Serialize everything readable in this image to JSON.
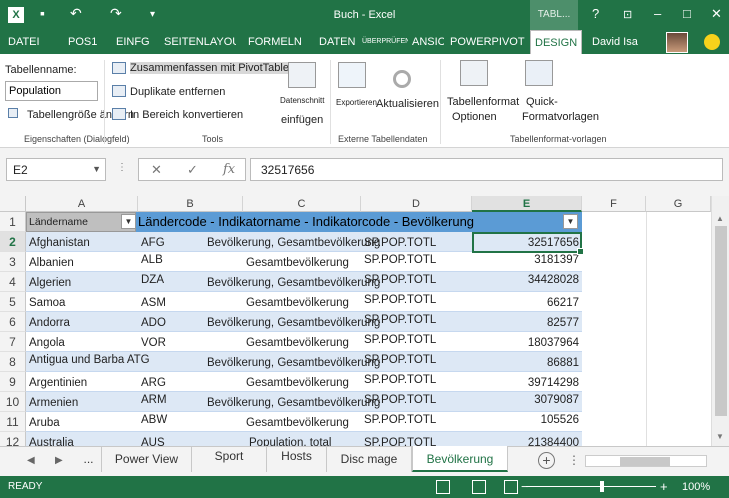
{
  "titlebar": {
    "app_icon": "X",
    "title": "Buch - Excel",
    "context_tab": "TABL...",
    "help": "?",
    "minimize": "–",
    "restore": "□",
    "close": "✕"
  },
  "ribbon_tabs": [
    "DATEI",
    "POS1",
    "EINFG",
    "SEITENLAYOU",
    "FORMELN",
    "DATEN",
    "ÜBERPRÜFEN",
    "ANSICHT",
    "POWERPIVOT",
    "DESIGN"
  ],
  "user": "David Isa",
  "ribbon": {
    "table_name_label": "Tabellenname:",
    "table_name_value": "Population",
    "resize_table": "Tabellengröße ändern",
    "summarize_pivot": "Zusammenfassen mit PivotTable",
    "remove_duplicates": "Duplikate entfernen",
    "convert_range": "In Bereich konvertieren",
    "slicer_label": "Datenschnitt",
    "slicer_label2": "einfügen",
    "export_label": "Exportieren",
    "refresh_label": "Aktualisieren",
    "style_options": "Tabellenformat",
    "style_options2": "Optionen",
    "quick_styles": "Quick-",
    "quick_styles2": "Formatvorlagen",
    "group_properties": "Eigenschaften (Dialogfeld)",
    "group_tools": "Tools",
    "group_external": "Externe Tabellendaten",
    "group_styles": "Tabellenformat-vorlagen"
  },
  "formula_bar": {
    "cell_ref": "E2",
    "cancel": "✕",
    "confirm": "✓",
    "fx": "fx",
    "value": "32517656"
  },
  "columns": [
    "A",
    "B",
    "C",
    "D",
    "E",
    "F",
    "G"
  ],
  "table_header": {
    "col_a": "Ländername",
    "merged": "Ländercode - Indikatorname - Indikatorcode - Bevölkerung"
  },
  "rows": [
    {
      "num": "1"
    },
    {
      "num": "2",
      "a": "Afghanistan",
      "b": "AFG",
      "c": "Bevölkerung, Gesamtbevölkerung",
      "d": "SP.POP.TOTL",
      "e": "32517656"
    },
    {
      "num": "3",
      "a": "Albanien",
      "b": "ALB",
      "c": "Gesamtbevölkerung",
      "d": "SP.POP.TOTL",
      "e": "3181397"
    },
    {
      "num": "4",
      "a": "Algerien",
      "b": "DZA",
      "c": "Bevölkerung, Gesamtbevölkerung",
      "d": "SP.POP.TOTL",
      "e": "34428028"
    },
    {
      "num": "5",
      "a": "Samoa",
      "b": "ASM",
      "c": "Gesamtbevölkerung",
      "d": "SP.POP.TOTL",
      "e": "66217"
    },
    {
      "num": "6",
      "a": "Andorra",
      "b": "ADO",
      "c": "Bevölkerung, Gesamtbevölkerung",
      "d": "SP.POP.TOTL",
      "e": "82577"
    },
    {
      "num": "7",
      "a": "Angola",
      "b": "VOR",
      "c": "Gesamtbevölkerung",
      "d": "SP.POP.TOTL",
      "e": "18037964"
    },
    {
      "num": "8",
      "a": "Antigua und Barba ATG",
      "b": "",
      "c": "Bevölkerung, Gesamtbevölkerung",
      "d": "SP.POP.TOTL",
      "e": "86881"
    },
    {
      "num": "9",
      "a": "Argentinien",
      "b": "ARG",
      "c": "Gesamtbevölkerung",
      "d": "SP.POP.TOTL",
      "e": "39714298"
    },
    {
      "num": "10",
      "a": "Armenien",
      "b": "ARM",
      "c": "Bevölkerung, Gesamtbevölkerung",
      "d": "SP.POP.TOTL",
      "e": "3079087"
    },
    {
      "num": "11",
      "a": "Aruba",
      "b": "ABW",
      "c": "Gesamtbevölkerung",
      "d": "SP.POP.TOTL",
      "e": "105526"
    },
    {
      "num": "12",
      "a": "Australia",
      "b": "AUS",
      "c": "Population, total",
      "d": "SP.POP.TOTL",
      "e": "21384400"
    }
  ],
  "sheets": [
    "...",
    "Power View",
    "Sport",
    "Hosts",
    "Disc mage",
    "Bevölkerung"
  ],
  "status": {
    "ready": "READY",
    "zoom_minus": "−",
    "zoom_plus": "+",
    "zoom": "100%"
  }
}
